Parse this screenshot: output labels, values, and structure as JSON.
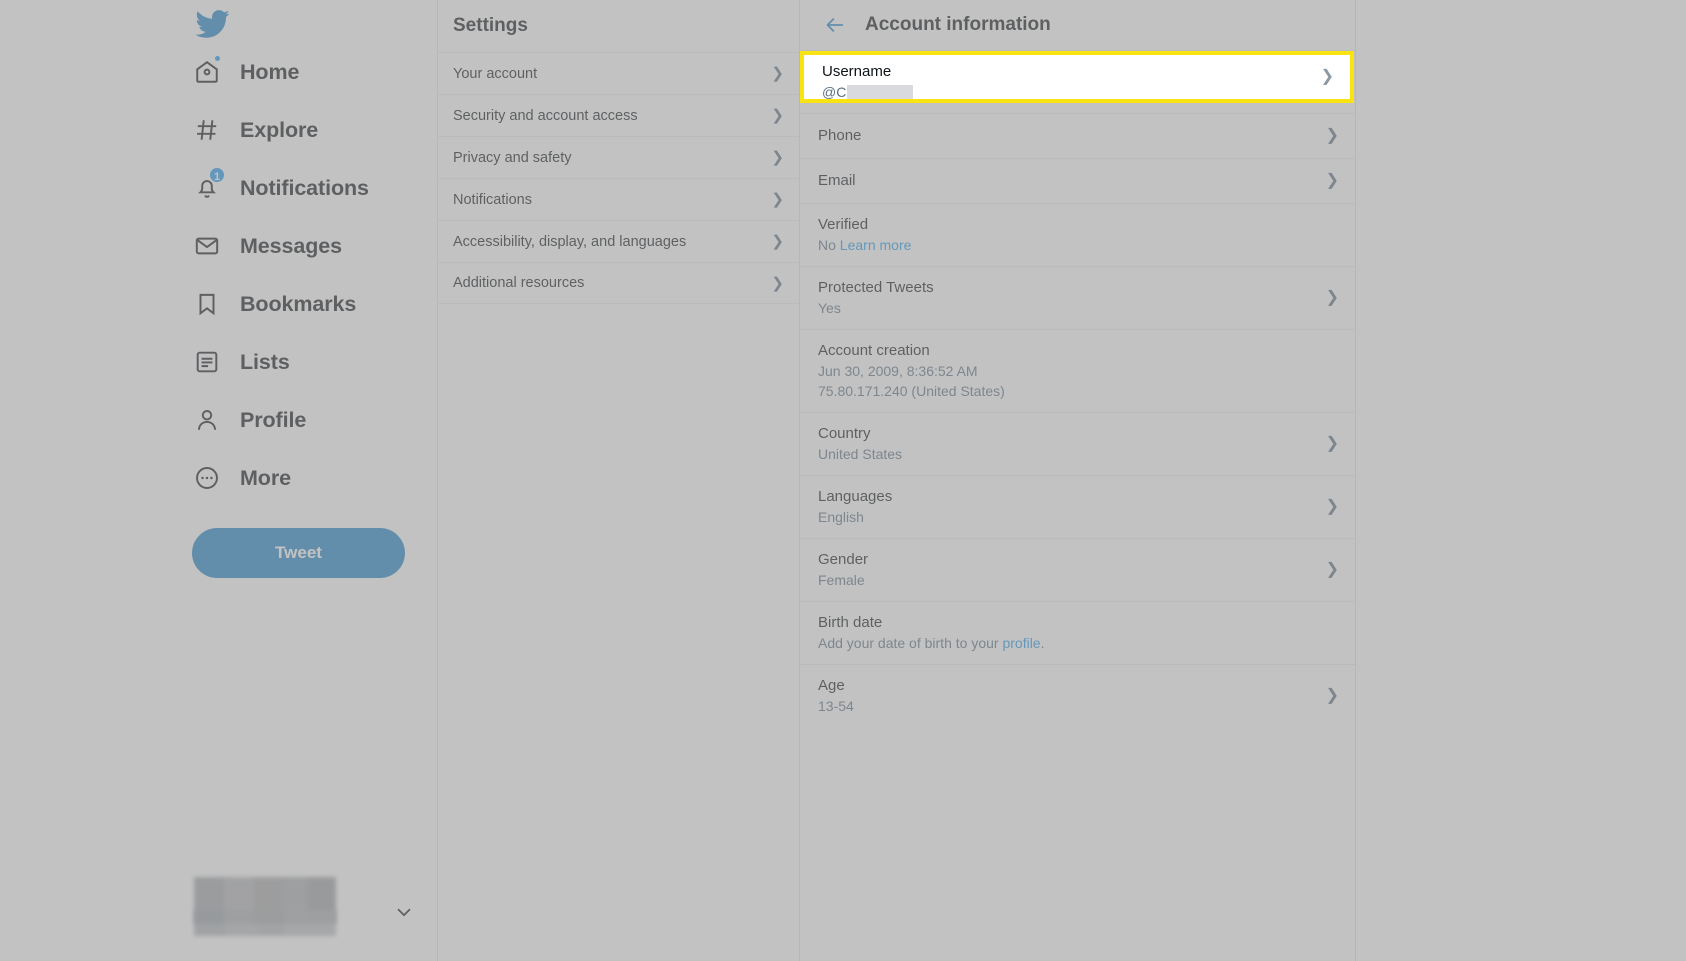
{
  "brand": {
    "accent": "#1d9bf0",
    "highlight": "#f9e312"
  },
  "sidebar": {
    "logo_icon": "twitter-bird-icon",
    "items": [
      {
        "label": "Home",
        "icon": "home-icon",
        "badge": "",
        "dot": true
      },
      {
        "label": "Explore",
        "icon": "hashtag-icon",
        "badge": "",
        "dot": false
      },
      {
        "label": "Notifications",
        "icon": "bell-icon",
        "badge": "1",
        "dot": false
      },
      {
        "label": "Messages",
        "icon": "envelope-icon",
        "badge": "",
        "dot": false
      },
      {
        "label": "Bookmarks",
        "icon": "bookmark-icon",
        "badge": "",
        "dot": false
      },
      {
        "label": "Lists",
        "icon": "list-icon",
        "badge": "",
        "dot": false
      },
      {
        "label": "Profile",
        "icon": "person-icon",
        "badge": "",
        "dot": false
      },
      {
        "label": "More",
        "icon": "more-circle-icon",
        "badge": "",
        "dot": false
      }
    ],
    "tweet_button": "Tweet",
    "account_chip": {
      "redacted": true,
      "chevron_icon": "chevron-down-icon"
    }
  },
  "settings": {
    "title": "Settings",
    "items": [
      "Your account",
      "Security and account access",
      "Privacy and safety",
      "Notifications",
      "Accessibility, display, and languages",
      "Additional resources"
    ],
    "chevron_icon": "chevron-right-icon"
  },
  "account_information": {
    "back_icon": "back-arrow-icon",
    "title": "Account information",
    "rows": [
      {
        "label": "Username",
        "value_prefix": "@C",
        "redacted": true,
        "chevron": true,
        "highlighted": true
      },
      {
        "label": "Phone",
        "value": "",
        "chevron": true
      },
      {
        "label": "Email",
        "value": "",
        "chevron": true
      },
      {
        "label": "Verified",
        "value": "No ",
        "link_text": "Learn more",
        "chevron": false
      },
      {
        "label": "Protected Tweets",
        "value": "Yes",
        "chevron": true
      },
      {
        "label": "Account creation",
        "value": "Jun 30, 2009, 8:36:52 AM",
        "value2": "75.80.171.240 (United States)",
        "chevron": false
      },
      {
        "label": "Country",
        "value": "United States",
        "chevron": true
      },
      {
        "label": "Languages",
        "value": "English",
        "chevron": true
      },
      {
        "label": "Gender",
        "value": "Female",
        "chevron": true
      },
      {
        "label": "Birth date",
        "value": "Add your date of birth to your ",
        "link_text": "profile",
        "value_suffix": ".",
        "chevron": false
      },
      {
        "label": "Age",
        "value": "13-54",
        "chevron": true
      }
    ]
  }
}
